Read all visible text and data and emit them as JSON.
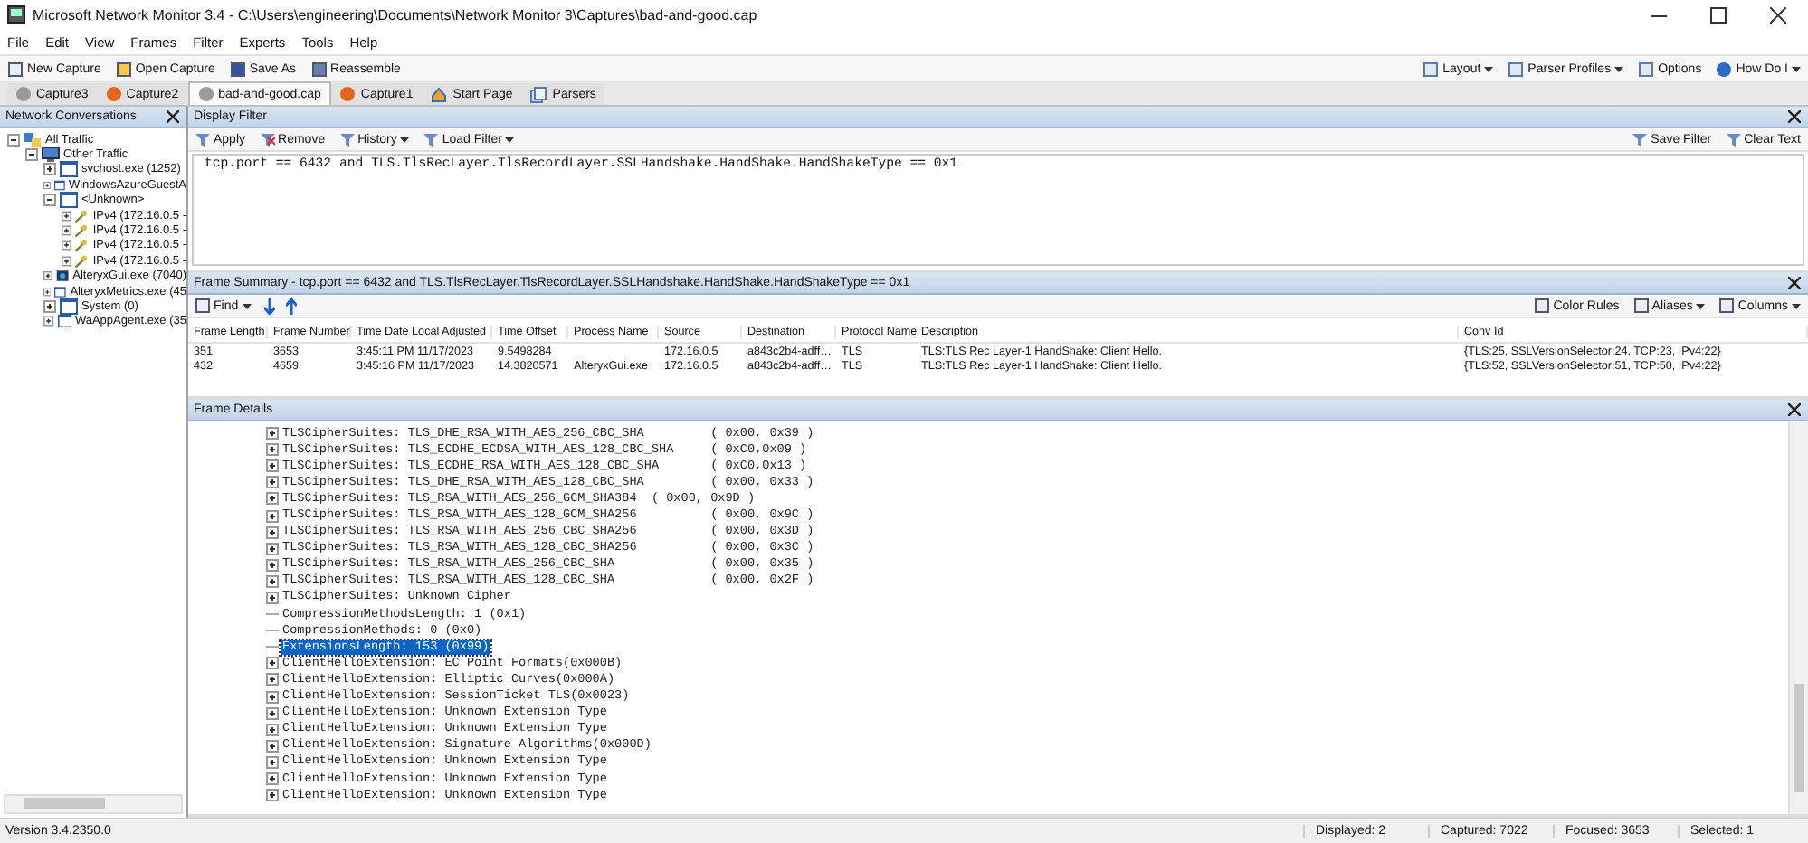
{
  "window": {
    "title": "Microsoft Network Monitor 3.4 - C:\\Users\\engineering\\Documents\\Network Monitor 3\\Captures\\bad-and-good.cap"
  },
  "menu": [
    "File",
    "Edit",
    "View",
    "Frames",
    "Filter",
    "Experts",
    "Tools",
    "Help"
  ],
  "toolbar": {
    "left": [
      {
        "label": "New Capture"
      },
      {
        "label": "Open Capture"
      },
      {
        "label": "Save As"
      },
      {
        "label": "Reassemble"
      }
    ],
    "right": [
      {
        "label": "Layout",
        "dropdown": true
      },
      {
        "label": "Parser Profiles",
        "dropdown": true
      },
      {
        "label": "Options",
        "dropdown": false
      },
      {
        "label": "How Do I",
        "dropdown": true
      }
    ]
  },
  "tabs": [
    {
      "label": "Capture3",
      "kind": "capture",
      "color": "#9a9a9a",
      "selected": false
    },
    {
      "label": "Capture2",
      "kind": "capture",
      "color": "#e8641e",
      "selected": false
    },
    {
      "label": "bad-and-good.cap",
      "kind": "capture",
      "color": "#9a9a9a",
      "selected": true
    },
    {
      "label": "Capture1",
      "kind": "capture",
      "color": "#e8641e",
      "selected": false
    },
    {
      "label": "Start Page",
      "kind": "start",
      "selected": false
    },
    {
      "label": "Parsers",
      "kind": "parsers",
      "selected": false
    }
  ],
  "conversations": {
    "title": "Network Conversations",
    "items": [
      {
        "label": "All Traffic",
        "kind": "group",
        "expanded": true,
        "children": [
          {
            "label": "Other Traffic",
            "kind": "monitor",
            "expanded": true,
            "children": [
              {
                "label": "svchost.exe (1252)",
                "kind": "process",
                "expanded": false
              },
              {
                "label": "WindowsAzureGuestA",
                "kind": "process",
                "expanded": false
              },
              {
                "label": "<Unknown>",
                "kind": "process",
                "expanded": true,
                "children": [
                  {
                    "label": "IPv4 (172.16.0.5 -",
                    "kind": "conversation",
                    "expanded": false
                  },
                  {
                    "label": "IPv4 (172.16.0.5 -",
                    "kind": "conversation",
                    "expanded": false
                  },
                  {
                    "label": "IPv4 (172.16.0.5 -",
                    "kind": "conversation",
                    "expanded": false
                  },
                  {
                    "label": "IPv4 (172.16.0.5 -",
                    "kind": "conversation",
                    "expanded": false
                  }
                ]
              },
              {
                "label": "AlteryxGui.exe (7040)",
                "kind": "app",
                "expanded": false
              },
              {
                "label": "AlteryxMetrics.exe (45",
                "kind": "process",
                "expanded": false
              },
              {
                "label": "System (0)",
                "kind": "process",
                "expanded": false
              },
              {
                "label": "WaAppAgent.exe (35",
                "kind": "process",
                "expanded": false
              }
            ]
          }
        ]
      }
    ]
  },
  "display_filter": {
    "title": "Display Filter",
    "actions": [
      {
        "label": "Apply",
        "dropdown": false
      },
      {
        "label": "Remove",
        "dropdown": false
      },
      {
        "label": "History",
        "dropdown": true
      },
      {
        "label": "Load Filter",
        "dropdown": true
      }
    ],
    "right_actions": [
      {
        "label": "Save Filter"
      },
      {
        "label": "Clear Text"
      }
    ],
    "value": "tcp.port == 6432 and TLS.TlsRecLayer.TlsRecordLayer.SSLHandshake.HandShake.HandShakeType == 0x1"
  },
  "frame_summary": {
    "title": "Frame Summary - tcp.port == 6432 and TLS.TlsRecLayer.TlsRecordLayer.SSLHandshake.HandShake.HandShakeType == 0x1",
    "find": "Find",
    "right_actions": [
      {
        "label": "Color Rules",
        "dropdown": false
      },
      {
        "label": "Aliases",
        "dropdown": true
      },
      {
        "label": "Columns",
        "dropdown": true
      }
    ],
    "columns": [
      "Frame Length",
      "Frame Number",
      "Time Date Local Adjusted",
      "Time Offset",
      "Process Name",
      "Source",
      "Destination",
      "Protocol Name",
      "Description",
      "Conv Id"
    ],
    "rows": [
      {
        "cells": [
          "351",
          "3653",
          "3:45:11 PM 11/17/2023",
          "9.5498284",
          "",
          "172.16.0.5",
          "a843c2b4-adff…",
          "TLS",
          "TLS:TLS Rec Layer-1 HandShake: Client Hello.",
          "{TLS:25, SSLVersionSelector:24, TCP:23, IPv4:22}"
        ]
      },
      {
        "cells": [
          "432",
          "4659",
          "3:45:16 PM 11/17/2023",
          "14.3820571",
          "AlteryxGui.exe",
          "172.16.0.5",
          "a843c2b4-adff…",
          "TLS",
          "TLS:TLS Rec Layer-1 HandShake: Client Hello.",
          "{TLS:52, SSLVersionSelector:51, TCP:50, IPv4:22}"
        ]
      }
    ]
  },
  "frame_details": {
    "title": "Frame Details",
    "lines": [
      {
        "text": "TLSCipherSuites: TLS_DHE_RSA_WITH_AES_256_CBC_SHA         ( 0x00, 0x39 )",
        "expandable": true,
        "selected": false
      },
      {
        "text": "TLSCipherSuites: TLS_ECDHE_ECDSA_WITH_AES_128_CBC_SHA     ( 0xC0,0x09 )",
        "expandable": true,
        "selected": false
      },
      {
        "text": "TLSCipherSuites: TLS_ECDHE_RSA_WITH_AES_128_CBC_SHA       ( 0xC0,0x13 )",
        "expandable": true,
        "selected": false
      },
      {
        "text": "TLSCipherSuites: TLS_DHE_RSA_WITH_AES_128_CBC_SHA         ( 0x00, 0x33 )",
        "expandable": true,
        "selected": false
      },
      {
        "text": "TLSCipherSuites: TLS_RSA_WITH_AES_256_GCM_SHA384  ( 0x00, 0x9D )",
        "expandable": true,
        "selected": false
      },
      {
        "text": "TLSCipherSuites: TLS_RSA_WITH_AES_128_GCM_SHA256          ( 0x00, 0x9C )",
        "expandable": true,
        "selected": false
      },
      {
        "text": "TLSCipherSuites: TLS_RSA_WITH_AES_256_CBC_SHA256          ( 0x00, 0x3D )",
        "expandable": true,
        "selected": false
      },
      {
        "text": "TLSCipherSuites: TLS_RSA_WITH_AES_128_CBC_SHA256          ( 0x00, 0x3C )",
        "expandable": true,
        "selected": false
      },
      {
        "text": "TLSCipherSuites: TLS_RSA_WITH_AES_256_CBC_SHA             ( 0x00, 0x35 )",
        "expandable": true,
        "selected": false
      },
      {
        "text": "TLSCipherSuites: TLS_RSA_WITH_AES_128_CBC_SHA             ( 0x00, 0x2F )",
        "expandable": true,
        "selected": false
      },
      {
        "text": "TLSCipherSuites: Unknown Cipher",
        "expandable": true,
        "selected": false
      },
      {
        "text": "CompressionMethodsLength: 1 (0x1)",
        "expandable": false,
        "selected": false
      },
      {
        "text": "CompressionMethods: 0 (0x0)",
        "expandable": false,
        "selected": false
      },
      {
        "text": "ExtensionsLength: 153 (0x99)",
        "expandable": false,
        "selected": true
      },
      {
        "text": "ClientHelloExtension: EC Point Formats(0x000B)",
        "expandable": true,
        "selected": false
      },
      {
        "text": "ClientHelloExtension: Elliptic Curves(0x000A)",
        "expandable": true,
        "selected": false
      },
      {
        "text": "ClientHelloExtension: SessionTicket TLS(0x0023)",
        "expandable": true,
        "selected": false
      },
      {
        "text": "ClientHelloExtension: Unknown Extension Type",
        "expandable": true,
        "selected": false
      },
      {
        "text": "ClientHelloExtension: Unknown Extension Type",
        "expandable": true,
        "selected": false
      },
      {
        "text": "ClientHelloExtension: Signature Algorithms(0x000D)",
        "expandable": true,
        "selected": false
      },
      {
        "text": "ClientHelloExtension: Unknown Extension Type",
        "expandable": true,
        "selected": false
      },
      {
        "text": "ClientHelloExtension: Unknown Extension Type",
        "expandable": true,
        "selected": false
      },
      {
        "text": "ClientHelloExtension: Unknown Extension Type",
        "expandable": true,
        "selected": false
      }
    ]
  },
  "status_bar": {
    "version": "Version 3.4.2350.0",
    "counters": [
      "Displayed: 2",
      "Captured: 7022",
      "Focused: 3653",
      "Selected: 1"
    ]
  }
}
